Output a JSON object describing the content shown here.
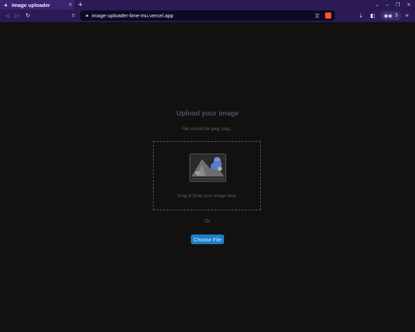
{
  "browser": {
    "tab_title": "Image uploader",
    "tab_close": "×",
    "new_tab": "+",
    "url": "image-uploader-lime-mu.vercel.app",
    "vpn_count": "3",
    "icons": [
      "tab-favicon-icon",
      "back-icon",
      "forward-icon",
      "reload-icon",
      "bookmark-icon",
      "lock-icon",
      "translate-icon",
      "brave-shield-icon",
      "download-icon",
      "sidebar-icon",
      "vpn-icon",
      "menu-icon",
      "minimize-icon",
      "maximize-icon",
      "close-icon"
    ]
  },
  "uploader": {
    "heading": "Upload your image",
    "subtitle": "File should be jpeg, png...",
    "drop_text": "Drag & Drop your image here",
    "or_text": "Or",
    "choose_button": "Choose File"
  },
  "colors": {
    "page_bg": "#121110",
    "browser_bg": "#2b1a55",
    "button_bg": "#1d7fc8",
    "heading": "#4a5263"
  }
}
